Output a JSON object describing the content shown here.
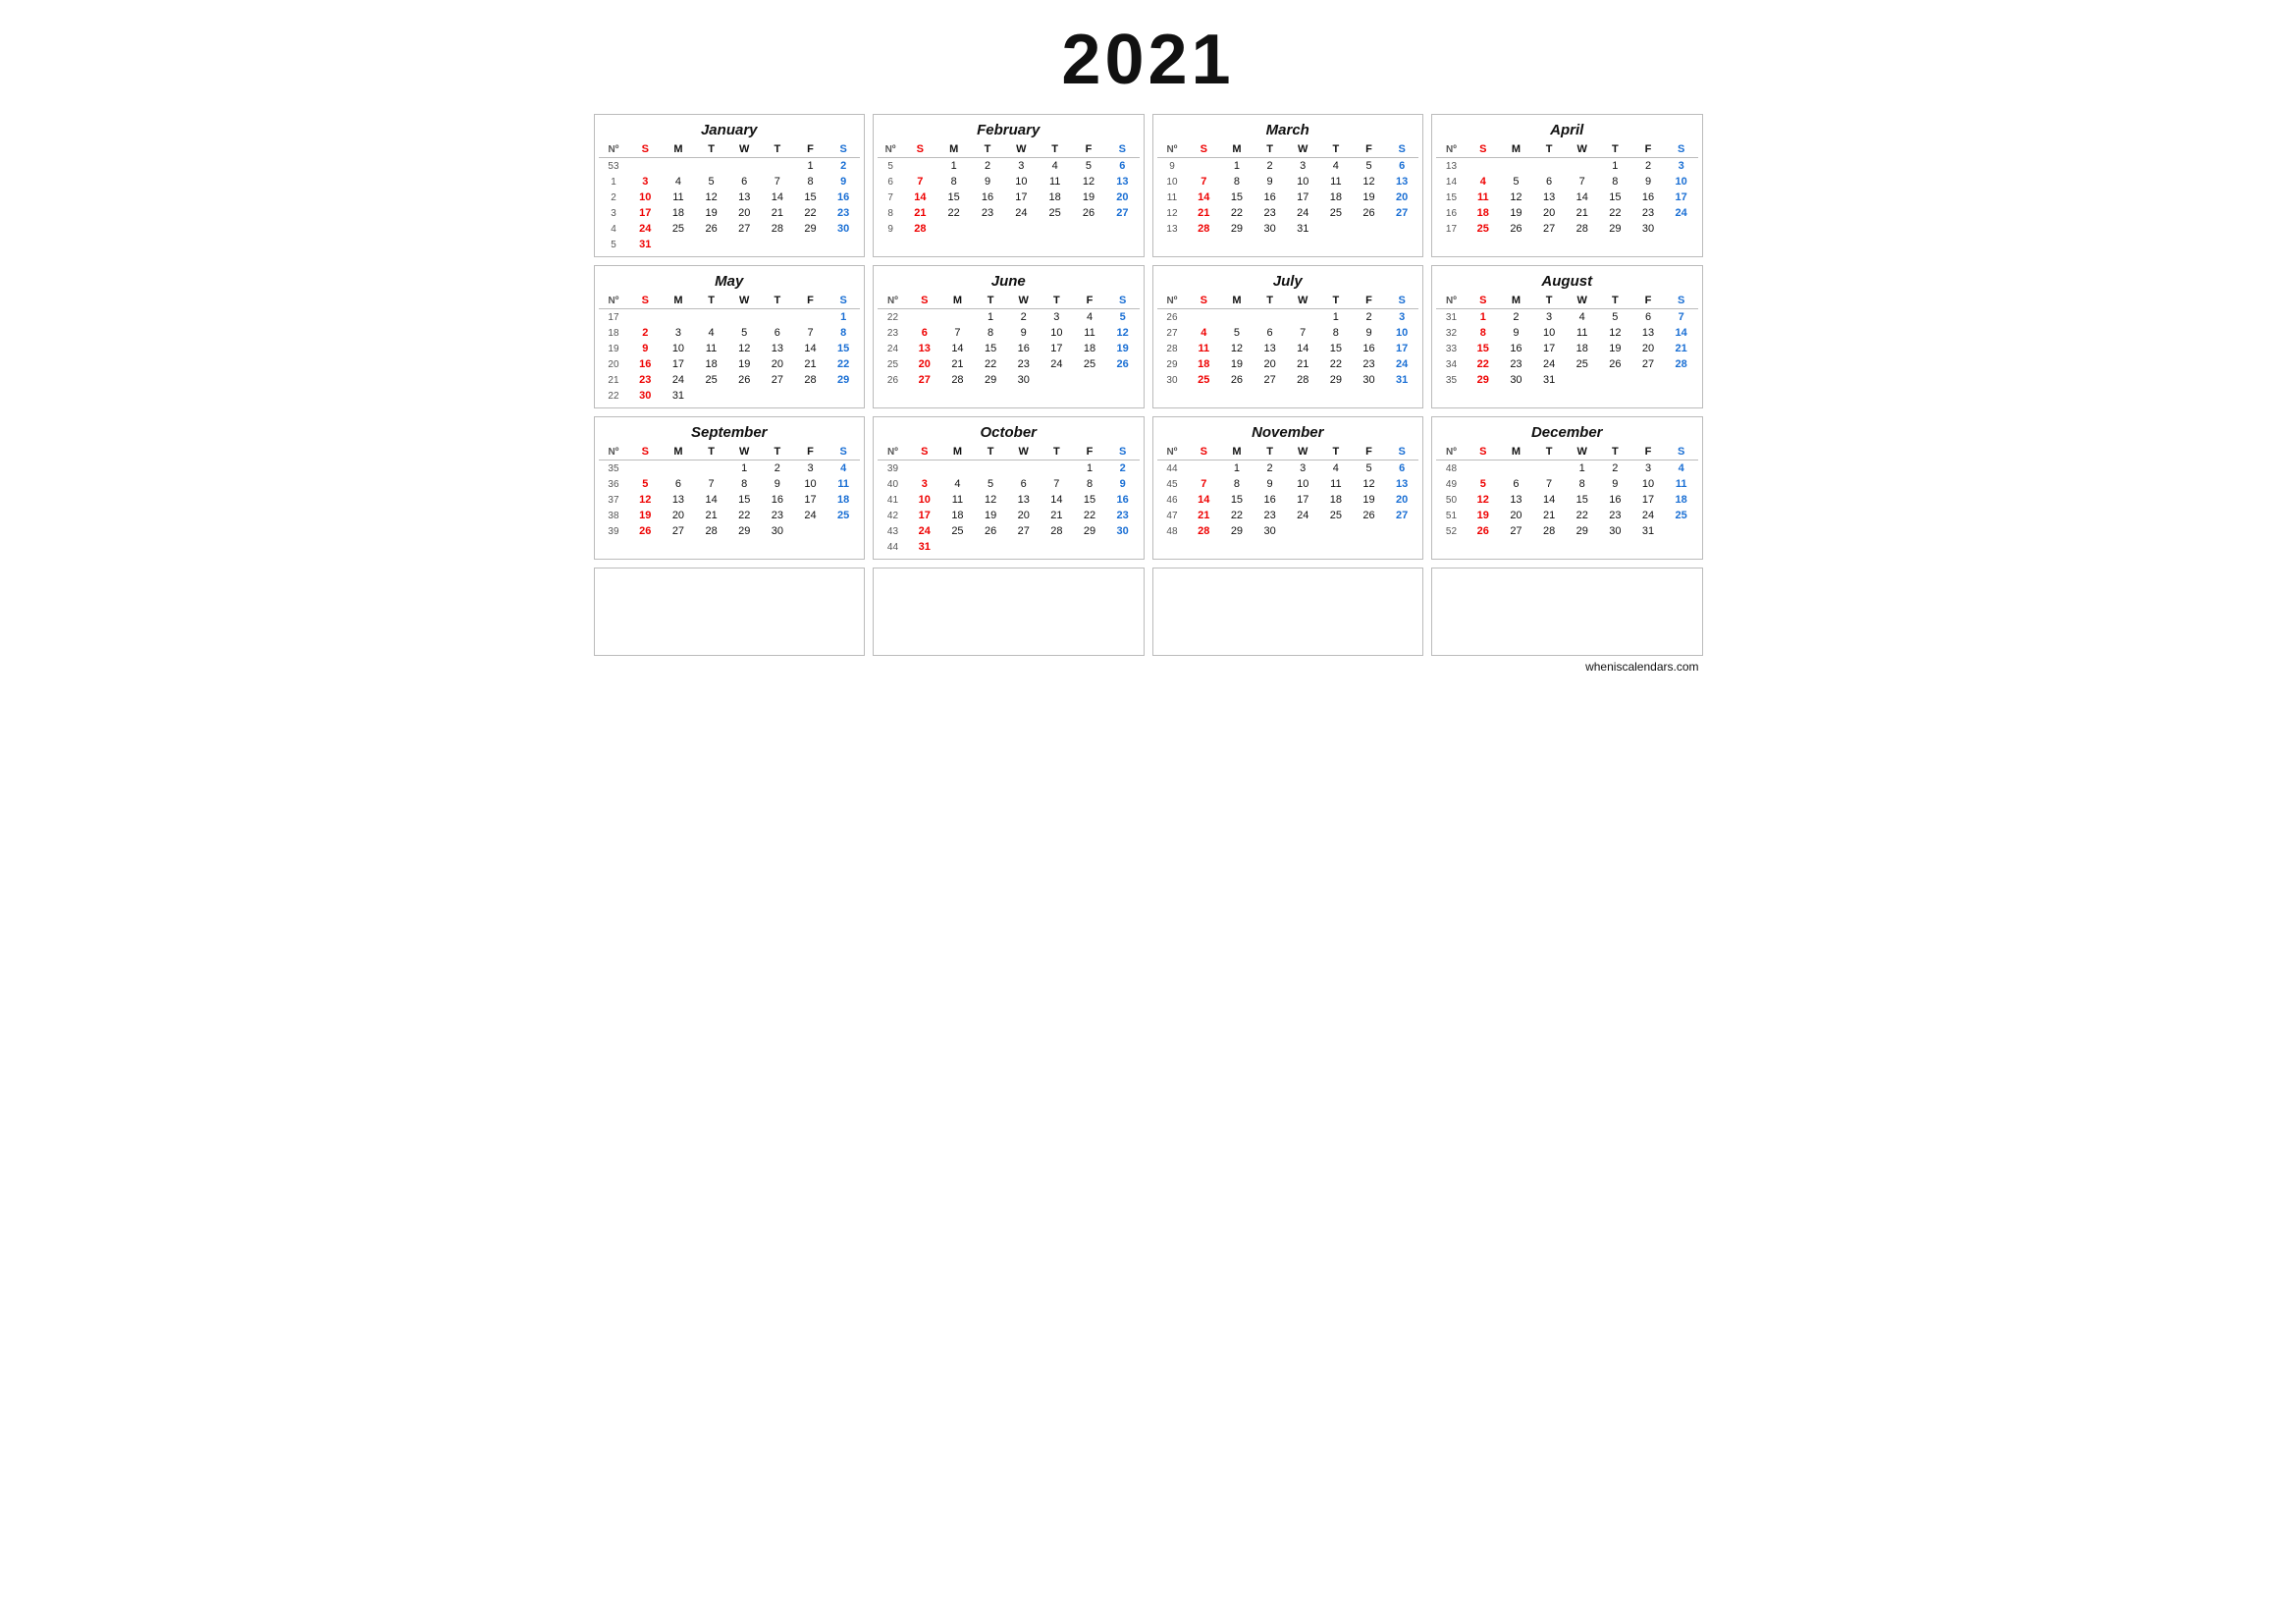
{
  "year": "2021",
  "months": [
    {
      "name": "January",
      "weeks": [
        {
          "wn": "53",
          "days": [
            "",
            "",
            "",
            "",
            "",
            "1",
            "2"
          ]
        },
        {
          "wn": "1",
          "days": [
            "3",
            "4",
            "5",
            "6",
            "7",
            "8",
            "9"
          ]
        },
        {
          "wn": "2",
          "days": [
            "10",
            "11",
            "12",
            "13",
            "14",
            "15",
            "16"
          ]
        },
        {
          "wn": "3",
          "days": [
            "17",
            "18",
            "19",
            "20",
            "21",
            "22",
            "23"
          ]
        },
        {
          "wn": "4",
          "days": [
            "24",
            "25",
            "26",
            "27",
            "28",
            "29",
            "30"
          ]
        },
        {
          "wn": "5",
          "days": [
            "31",
            "",
            "",
            "",
            "",
            "",
            ""
          ]
        }
      ]
    },
    {
      "name": "February",
      "weeks": [
        {
          "wn": "5",
          "days": [
            "",
            "1",
            "2",
            "3",
            "4",
            "5",
            "6"
          ]
        },
        {
          "wn": "6",
          "days": [
            "7",
            "8",
            "9",
            "10",
            "11",
            "12",
            "13"
          ]
        },
        {
          "wn": "7",
          "days": [
            "14",
            "15",
            "16",
            "17",
            "18",
            "19",
            "20"
          ]
        },
        {
          "wn": "8",
          "days": [
            "21",
            "22",
            "23",
            "24",
            "25",
            "26",
            "27"
          ]
        },
        {
          "wn": "9",
          "days": [
            "28",
            "",
            "",
            "",
            "",
            "",
            ""
          ]
        }
      ]
    },
    {
      "name": "March",
      "weeks": [
        {
          "wn": "9",
          "days": [
            "",
            "1",
            "2",
            "3",
            "4",
            "5",
            "6"
          ]
        },
        {
          "wn": "10",
          "days": [
            "7",
            "8",
            "9",
            "10",
            "11",
            "12",
            "13"
          ]
        },
        {
          "wn": "11",
          "days": [
            "14",
            "15",
            "16",
            "17",
            "18",
            "19",
            "20"
          ]
        },
        {
          "wn": "12",
          "days": [
            "21",
            "22",
            "23",
            "24",
            "25",
            "26",
            "27"
          ]
        },
        {
          "wn": "13",
          "days": [
            "28",
            "29",
            "30",
            "31",
            "",
            "",
            ""
          ]
        }
      ]
    },
    {
      "name": "April",
      "weeks": [
        {
          "wn": "13",
          "days": [
            "",
            "",
            "",
            "",
            "1",
            "2",
            "3"
          ]
        },
        {
          "wn": "14",
          "days": [
            "4",
            "5",
            "6",
            "7",
            "8",
            "9",
            "10"
          ]
        },
        {
          "wn": "15",
          "days": [
            "11",
            "12",
            "13",
            "14",
            "15",
            "16",
            "17"
          ]
        },
        {
          "wn": "16",
          "days": [
            "18",
            "19",
            "20",
            "21",
            "22",
            "23",
            "24"
          ]
        },
        {
          "wn": "17",
          "days": [
            "25",
            "26",
            "27",
            "28",
            "29",
            "30",
            ""
          ]
        }
      ]
    },
    {
      "name": "May",
      "weeks": [
        {
          "wn": "17",
          "days": [
            "",
            "",
            "",
            "",
            "",
            "",
            "1"
          ]
        },
        {
          "wn": "18",
          "days": [
            "2",
            "3",
            "4",
            "5",
            "6",
            "7",
            "8"
          ]
        },
        {
          "wn": "19",
          "days": [
            "9",
            "10",
            "11",
            "12",
            "13",
            "14",
            "15"
          ]
        },
        {
          "wn": "20",
          "days": [
            "16",
            "17",
            "18",
            "19",
            "20",
            "21",
            "22"
          ]
        },
        {
          "wn": "21",
          "days": [
            "23",
            "24",
            "25",
            "26",
            "27",
            "28",
            "29"
          ]
        },
        {
          "wn": "22",
          "days": [
            "30",
            "31",
            "",
            "",
            "",
            "",
            ""
          ]
        }
      ]
    },
    {
      "name": "June",
      "weeks": [
        {
          "wn": "22",
          "days": [
            "",
            "",
            "1",
            "2",
            "3",
            "4",
            "5"
          ]
        },
        {
          "wn": "23",
          "days": [
            "6",
            "7",
            "8",
            "9",
            "10",
            "11",
            "12"
          ]
        },
        {
          "wn": "24",
          "days": [
            "13",
            "14",
            "15",
            "16",
            "17",
            "18",
            "19"
          ]
        },
        {
          "wn": "25",
          "days": [
            "20",
            "21",
            "22",
            "23",
            "24",
            "25",
            "26"
          ]
        },
        {
          "wn": "26",
          "days": [
            "27",
            "28",
            "29",
            "30",
            "",
            "",
            ""
          ]
        }
      ]
    },
    {
      "name": "July",
      "weeks": [
        {
          "wn": "26",
          "days": [
            "",
            "",
            "",
            "",
            "1",
            "2",
            "3"
          ]
        },
        {
          "wn": "27",
          "days": [
            "4",
            "5",
            "6",
            "7",
            "8",
            "9",
            "10"
          ]
        },
        {
          "wn": "28",
          "days": [
            "11",
            "12",
            "13",
            "14",
            "15",
            "16",
            "17"
          ]
        },
        {
          "wn": "29",
          "days": [
            "18",
            "19",
            "20",
            "21",
            "22",
            "23",
            "24"
          ]
        },
        {
          "wn": "30",
          "days": [
            "25",
            "26",
            "27",
            "28",
            "29",
            "30",
            "31"
          ]
        }
      ]
    },
    {
      "name": "August",
      "weeks": [
        {
          "wn": "31",
          "days": [
            "1",
            "2",
            "3",
            "4",
            "5",
            "6",
            "7"
          ]
        },
        {
          "wn": "32",
          "days": [
            "8",
            "9",
            "10",
            "11",
            "12",
            "13",
            "14"
          ]
        },
        {
          "wn": "33",
          "days": [
            "15",
            "16",
            "17",
            "18",
            "19",
            "20",
            "21"
          ]
        },
        {
          "wn": "34",
          "days": [
            "22",
            "23",
            "24",
            "25",
            "26",
            "27",
            "28"
          ]
        },
        {
          "wn": "35",
          "days": [
            "29",
            "30",
            "31",
            "",
            "",
            "",
            ""
          ]
        }
      ]
    },
    {
      "name": "September",
      "weeks": [
        {
          "wn": "35",
          "days": [
            "",
            "",
            "",
            "1",
            "2",
            "3",
            "4"
          ]
        },
        {
          "wn": "36",
          "days": [
            "5",
            "6",
            "7",
            "8",
            "9",
            "10",
            "11"
          ]
        },
        {
          "wn": "37",
          "days": [
            "12",
            "13",
            "14",
            "15",
            "16",
            "17",
            "18"
          ]
        },
        {
          "wn": "38",
          "days": [
            "19",
            "20",
            "21",
            "22",
            "23",
            "24",
            "25"
          ]
        },
        {
          "wn": "39",
          "days": [
            "26",
            "27",
            "28",
            "29",
            "30",
            "",
            ""
          ]
        }
      ]
    },
    {
      "name": "October",
      "weeks": [
        {
          "wn": "39",
          "days": [
            "",
            "",
            "",
            "",
            "",
            "1",
            "2"
          ]
        },
        {
          "wn": "40",
          "days": [
            "3",
            "4",
            "5",
            "6",
            "7",
            "8",
            "9"
          ]
        },
        {
          "wn": "41",
          "days": [
            "10",
            "11",
            "12",
            "13",
            "14",
            "15",
            "16"
          ]
        },
        {
          "wn": "42",
          "days": [
            "17",
            "18",
            "19",
            "20",
            "21",
            "22",
            "23"
          ]
        },
        {
          "wn": "43",
          "days": [
            "24",
            "25",
            "26",
            "27",
            "28",
            "29",
            "30"
          ]
        },
        {
          "wn": "44",
          "days": [
            "31",
            "",
            "",
            "",
            "",
            "",
            ""
          ]
        }
      ]
    },
    {
      "name": "November",
      "weeks": [
        {
          "wn": "44",
          "days": [
            "",
            "1",
            "2",
            "3",
            "4",
            "5",
            "6"
          ]
        },
        {
          "wn": "45",
          "days": [
            "7",
            "8",
            "9",
            "10",
            "11",
            "12",
            "13"
          ]
        },
        {
          "wn": "46",
          "days": [
            "14",
            "15",
            "16",
            "17",
            "18",
            "19",
            "20"
          ]
        },
        {
          "wn": "47",
          "days": [
            "21",
            "22",
            "23",
            "24",
            "25",
            "26",
            "27"
          ]
        },
        {
          "wn": "48",
          "days": [
            "28",
            "29",
            "30",
            "",
            "",
            "",
            ""
          ]
        }
      ]
    },
    {
      "name": "December",
      "weeks": [
        {
          "wn": "48",
          "days": [
            "",
            "",
            "",
            "1",
            "2",
            "3",
            "4"
          ]
        },
        {
          "wn": "49",
          "days": [
            "5",
            "6",
            "7",
            "8",
            "9",
            "10",
            "11"
          ]
        },
        {
          "wn": "50",
          "days": [
            "12",
            "13",
            "14",
            "15",
            "16",
            "17",
            "18"
          ]
        },
        {
          "wn": "51",
          "days": [
            "19",
            "20",
            "21",
            "22",
            "23",
            "24",
            "25"
          ]
        },
        {
          "wn": "52",
          "days": [
            "26",
            "27",
            "28",
            "29",
            "30",
            "31",
            ""
          ]
        }
      ]
    }
  ],
  "days_header": [
    "Nº",
    "S",
    "M",
    "T",
    "W",
    "T",
    "F",
    "S"
  ],
  "footer": {
    "text": "wheniscalendars.com",
    "when": "whenis",
    "calendars": "calendars.com"
  }
}
